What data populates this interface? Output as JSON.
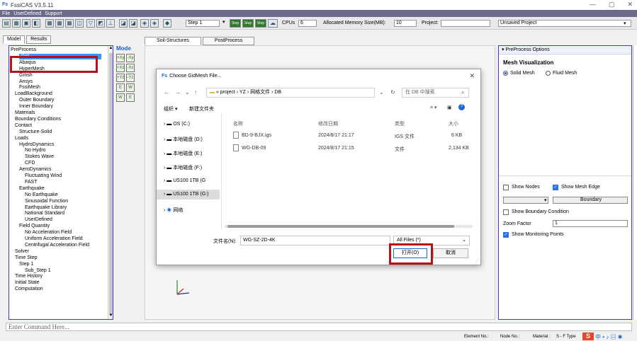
{
  "app": {
    "title": "FssiCAS V3.5.11",
    "icon_glyph": "Fs",
    "window_buttons": [
      "—",
      "▢",
      "✕"
    ]
  },
  "menu": [
    "File",
    "UserDefined",
    "Support"
  ],
  "toolbar": {
    "step_label": "Step 1",
    "cpus_label": "CPUs",
    "cpus_value": "6",
    "memory_label": "Allocated Memory Size(MB):",
    "memory_value": "10",
    "project_label": "Project:",
    "project_value": "Unsaved Project",
    "step_icons": [
      "Step",
      "Step",
      "Step"
    ]
  },
  "left_tabs": [
    "Model",
    "Results"
  ],
  "center_tabs": [
    "Soil-Structures",
    "PostProcess"
  ],
  "mode_label": "Mode",
  "mode_buttons": [
    "+Xy",
    "-Xy",
    "+Xz",
    "-Xz",
    "+Yz",
    "-Yz",
    "E",
    "W",
    "W",
    "E"
  ],
  "tree": [
    {
      "label": "PreProcess",
      "level": 0
    },
    {
      "label": "Gid",
      "level": 2,
      "selected": true
    },
    {
      "label": "Abaqus",
      "level": 2
    },
    {
      "label": "HyperMesh",
      "level": 2
    },
    {
      "label": "Gmsh",
      "level": 2
    },
    {
      "label": "Ansys",
      "level": 2
    },
    {
      "label": "FssiMesh",
      "level": 2
    },
    {
      "label": "LoadBackground",
      "level": 1
    },
    {
      "label": "Outer Boundary",
      "level": 2
    },
    {
      "label": "Inner Boundary",
      "level": 2
    },
    {
      "label": "Materials",
      "level": 1
    },
    {
      "label": "Boundary Conditions",
      "level": 1
    },
    {
      "label": "Contact",
      "level": 1
    },
    {
      "label": "Structure-Solid",
      "level": 2
    },
    {
      "label": "Loads",
      "level": 1
    },
    {
      "label": "HydroDynamics",
      "level": 2
    },
    {
      "label": "No Hydro",
      "level": 3
    },
    {
      "label": "Stokes Wave",
      "level": 3
    },
    {
      "label": "CFD",
      "level": 3
    },
    {
      "label": "AeroDynamics",
      "level": 2
    },
    {
      "label": "Fluctuating Wind",
      "level": 3
    },
    {
      "label": "FAST",
      "level": 3
    },
    {
      "label": "Earthquake",
      "level": 2
    },
    {
      "label": "No Earthquake",
      "level": 3
    },
    {
      "label": "Sinusoidal Function",
      "level": 3
    },
    {
      "label": "Earthquake Library",
      "level": 3
    },
    {
      "label": "National Standard",
      "level": 3
    },
    {
      "label": "UserDefined",
      "level": 3
    },
    {
      "label": "Field Quantity",
      "level": 2
    },
    {
      "label": "No Acceleration Field",
      "level": 3
    },
    {
      "label": "Uniform Acceleration Field",
      "level": 3
    },
    {
      "label": "Centrifugal Acceleration Field",
      "level": 3
    },
    {
      "label": "Solver",
      "level": 1
    },
    {
      "label": "Time Step",
      "level": 1
    },
    {
      "label": "Step 1",
      "level": 2
    },
    {
      "label": "Sub_Step 1",
      "level": 3
    },
    {
      "label": "Time History",
      "level": 1
    },
    {
      "label": "Initial State",
      "level": 1
    },
    {
      "label": "Computation",
      "level": 1
    }
  ],
  "right_panel": {
    "header": "PreProcess Options",
    "section_title": "Mesh Visualization",
    "radio_solid": "Solid Mesh",
    "radio_fluid": "Fluid Mesh",
    "show_nodes": "Show Nodes",
    "show_mesh_edge": "Show Mesh Edge",
    "boundary_select": "Boundary",
    "show_boundary_condition": "Show Boundary Condition",
    "zoom_label": "Zoom Factor",
    "zoom_value": "1",
    "show_monitoring_points": "Show Monitoring Points"
  },
  "dialog": {
    "title": "Choose GidMesh File...",
    "address": [
      "project",
      "YZ",
      "网格文件",
      "DB"
    ],
    "search_placeholder": "在 DB 中搜索",
    "organize": "组织 ▾",
    "new_folder": "新建文件夹",
    "nav_items": [
      "OS (C:)",
      "本地磁盘 (D:)",
      "本地磁盘 (E:)",
      "本地磁盘 (F:)",
      "US100 1TB (G",
      "US100 1TB (G:)",
      "网络"
    ],
    "columns": [
      "名称",
      "修改日期",
      "类型",
      "大小"
    ],
    "files": [
      {
        "name": "BD-9-BJX.igs",
        "date": "2024/8/17 21:17",
        "type": "IGS 文件",
        "size": "6 KB"
      },
      {
        "name": "WG-DB-09",
        "date": "2024/8/17 21:15",
        "type": "文件",
        "size": "2,134 KB"
      }
    ],
    "filename_label": "文件名(N):",
    "filename_value": "WG-SZ-2D-4K",
    "filetype_value": "All Files (*)",
    "open_button": "打开(O)",
    "cancel_button": "取消"
  },
  "command_placeholder": "Enter Command Here...",
  "status": {
    "element_no": "Element No.:",
    "node_no": "Node No.:",
    "material": "Material :",
    "material_value": "S - F Type"
  },
  "colors": {
    "accent_blue": "#3b3bd0",
    "highlight_red": "#b3121b",
    "selection": "#3399ff"
  }
}
